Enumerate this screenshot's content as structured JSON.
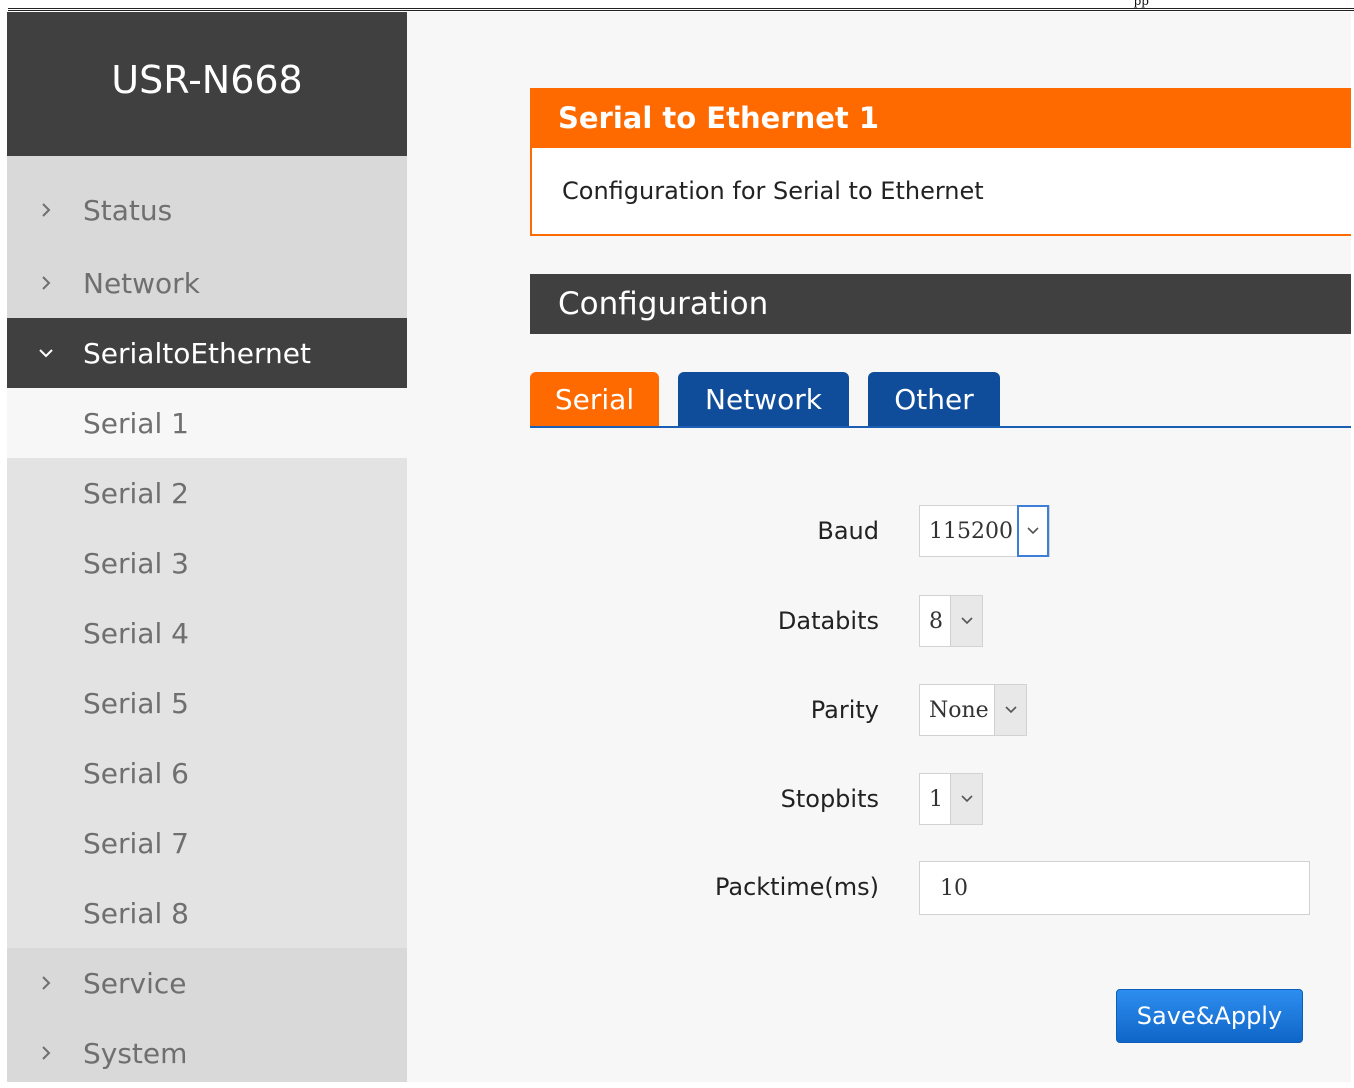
{
  "page_rule_text": "pp",
  "brand": {
    "title": "USR-N668"
  },
  "sidebar": {
    "items": [
      {
        "label": "Status"
      },
      {
        "label": "Network"
      },
      {
        "label": "SerialtoEthernet"
      },
      {
        "label": "Service"
      },
      {
        "label": "System"
      }
    ],
    "sub_items": [
      {
        "label": "Serial 1"
      },
      {
        "label": "Serial 2"
      },
      {
        "label": "Serial 3"
      },
      {
        "label": "Serial 4"
      },
      {
        "label": "Serial 5"
      },
      {
        "label": "Serial 6"
      },
      {
        "label": "Serial 7"
      },
      {
        "label": "Serial 8"
      }
    ]
  },
  "panel": {
    "title": "Serial to Ethernet 1",
    "description": "Configuration for Serial to Ethernet"
  },
  "section": {
    "title": "Configuration"
  },
  "tabs": [
    {
      "label": "Serial"
    },
    {
      "label": "Network"
    },
    {
      "label": "Other"
    }
  ],
  "form": {
    "baud": {
      "label": "Baud",
      "value": "115200"
    },
    "databits": {
      "label": "Databits",
      "value": "8"
    },
    "parity": {
      "label": "Parity",
      "value": "None"
    },
    "stopbits": {
      "label": "Stopbits",
      "value": "1"
    },
    "packtime": {
      "label": "Packtime(ms)",
      "value": "10"
    }
  },
  "actions": {
    "save_label": "Save&Apply"
  },
  "colors": {
    "accent_orange": "#ff6a00",
    "header_dark": "#404040",
    "tab_blue": "#0f4c99",
    "button_blue": "#1a7be0"
  },
  "icons": {
    "collapsed": "chevron-right-icon",
    "expanded": "chevron-down-icon",
    "dropdown": "chevron-down-icon"
  }
}
